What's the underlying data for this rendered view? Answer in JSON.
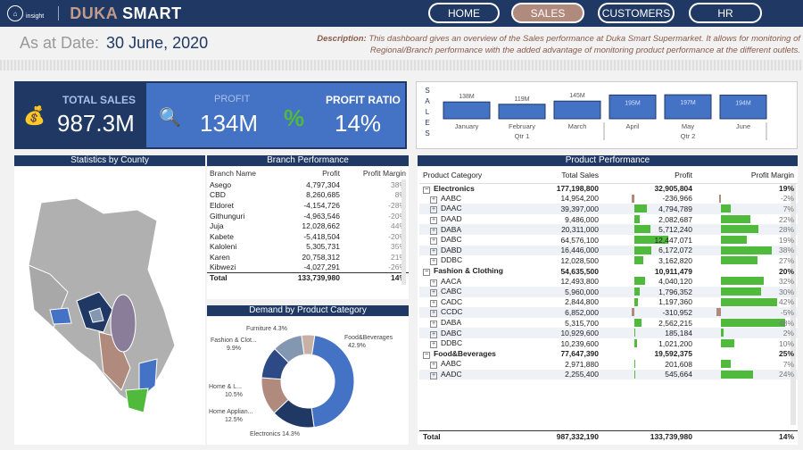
{
  "header": {
    "logo_text": "insight",
    "brand_first": "DUKA",
    "brand_second": "SMART"
  },
  "nav": [
    {
      "label": "HOME"
    },
    {
      "label": "SALES"
    },
    {
      "label": "CUSTOMERS"
    },
    {
      "label": "HR"
    }
  ],
  "date": {
    "label": "As at Date:",
    "value": "30 June, 2020"
  },
  "description": {
    "prefix": "Description:",
    "text": "This dashboard gives an overview of the Sales performance at Duka Smart Supermarket. It allows for monitoring of Regional/Branch performance  with the added advantage of monitoring product performance at the different outlets."
  },
  "kpis": {
    "total_sales": {
      "label": "TOTAL SALES",
      "value": "987.3M"
    },
    "profit": {
      "label": "PROFIT",
      "value": "134M"
    },
    "profit_ratio": {
      "label": "PROFIT RATIO",
      "value": "14%"
    }
  },
  "sales_chart": {
    "vertical_label": "SALES",
    "months": [
      {
        "month": "January",
        "value": "138M",
        "qtr": "Qtr 1"
      },
      {
        "month": "February",
        "value": "119M",
        "qtr": "Qtr 1"
      },
      {
        "month": "March",
        "value": "145M",
        "qtr": "Qtr 1"
      },
      {
        "month": "April",
        "value": "195M",
        "qtr": "Qtr 2"
      },
      {
        "month": "May",
        "value": "197M",
        "qtr": "Qtr 2"
      },
      {
        "month": "June",
        "value": "194M",
        "qtr": "Qtr 2"
      }
    ],
    "qtr1": "Qtr 1",
    "qtr2": "Qtr 2"
  },
  "chart_data": [
    {
      "type": "bar",
      "categories": [
        "January",
        "February",
        "March",
        "April",
        "May",
        "June"
      ],
      "values": [
        138,
        119,
        145,
        195,
        197,
        194
      ],
      "ylabel": "",
      "xlabel": ""
    },
    {
      "type": "pie",
      "categories": [
        "Food&Beverages",
        "Electronics",
        "Home Appliances",
        "Home & Living",
        "Fashion & Clothing",
        "Furniture"
      ],
      "values": [
        42.9,
        14.3,
        12.5,
        10.5,
        9.9,
        4.3
      ]
    }
  ],
  "county": {
    "title": "Statistics by County"
  },
  "branch": {
    "title": "Branch Performance",
    "headers": [
      "Branch Name",
      "Profit",
      "Profit Margin"
    ],
    "rows": [
      [
        "Asego",
        "4,797,304",
        "38%"
      ],
      [
        "CBD",
        "8,260,685",
        "8%"
      ],
      [
        "Eldoret",
        "-4,154,726",
        "-28%"
      ],
      [
        "Githunguri",
        "-4,963,546",
        "-20%"
      ],
      [
        "Juja",
        "12,028,662",
        "44%"
      ],
      [
        "Kabete",
        "-5,418,504",
        "-20%"
      ],
      [
        "Kaloleni",
        "5,305,731",
        "35%"
      ],
      [
        "Karen",
        "20,758,312",
        "21%"
      ],
      [
        "Kibwezi",
        "-4,027,291",
        "-26%"
      ]
    ],
    "total": [
      "Total",
      "133,739,980",
      "14%"
    ]
  },
  "demand": {
    "title": "Demand by Product Category",
    "labels": [
      {
        "name": "Food&Beverages",
        "pct": "42.9%"
      },
      {
        "name": "Electronics",
        "pct": "14.3%"
      },
      {
        "name": "Home Applian...",
        "pct": "12.5%"
      },
      {
        "name": "Home & L...",
        "pct": "10.5%"
      },
      {
        "name": "Fashion & Clot...",
        "pct": "9.9%"
      },
      {
        "name": "Furniture",
        "pct": "4.3%"
      }
    ],
    "colors": [
      "#4472c4",
      "#1f3864",
      "#b08a7c",
      "#2e4a86",
      "#8497b0",
      "#c9b0a6"
    ]
  },
  "product": {
    "title": "Product Performance",
    "headers": [
      "Product Category",
      "Total Sales",
      "Profit",
      "Profit Margin"
    ],
    "rows": [
      {
        "t": "grp",
        "c": "Electronics",
        "s": "177,198,800",
        "p": "32,905,804",
        "m": "19%"
      },
      {
        "t": "sub",
        "c": "AABC",
        "s": "14,954,200",
        "p": "-236,966",
        "m": "-2%",
        "pb": -1,
        "mb": -2
      },
      {
        "t": "sub",
        "c": "DAAC",
        "s": "39,397,000",
        "p": "4,794,789",
        "m": "7%",
        "pb": 20,
        "mb": 7
      },
      {
        "t": "sub",
        "c": "DAAD",
        "s": "9,486,000",
        "p": "2,082,687",
        "m": "22%",
        "pb": 9,
        "mb": 22
      },
      {
        "t": "sub",
        "c": "DABA",
        "s": "20,311,000",
        "p": "5,712,240",
        "m": "28%",
        "pb": 25,
        "mb": 28
      },
      {
        "t": "sub",
        "c": "DABC",
        "s": "64,576,100",
        "p": "12,447,071",
        "m": "19%",
        "pb": 54,
        "mb": 19
      },
      {
        "t": "sub",
        "c": "DABD",
        "s": "16,446,000",
        "p": "6,172,072",
        "m": "38%",
        "pb": 27,
        "mb": 38
      },
      {
        "t": "sub",
        "c": "DDBC",
        "s": "12,028,500",
        "p": "3,162,820",
        "m": "27%",
        "pb": 14,
        "mb": 27
      },
      {
        "t": "grp",
        "c": "Fashion & Clothing",
        "s": "54,635,500",
        "p": "10,911,479",
        "m": "20%"
      },
      {
        "t": "sub",
        "c": "AACA",
        "s": "12,493,800",
        "p": "4,040,120",
        "m": "32%",
        "pb": 17,
        "mb": 32
      },
      {
        "t": "sub",
        "c": "CABC",
        "s": "5,960,000",
        "p": "1,796,352",
        "m": "30%",
        "pb": 8,
        "mb": 30
      },
      {
        "t": "sub",
        "c": "CADC",
        "s": "2,844,800",
        "p": "1,197,360",
        "m": "42%",
        "pb": 5,
        "mb": 42
      },
      {
        "t": "sub",
        "c": "CCDC",
        "s": "6,852,000",
        "p": "-310,952",
        "m": "-5%",
        "pb": -1,
        "mb": -5
      },
      {
        "t": "sub",
        "c": "DABA",
        "s": "5,315,700",
        "p": "2,562,215",
        "m": "48%",
        "pb": 11,
        "mb": 48
      },
      {
        "t": "sub",
        "c": "DABC",
        "s": "10,929,600",
        "p": "185,184",
        "m": "2%",
        "pb": 1,
        "mb": 2
      },
      {
        "t": "sub",
        "c": "DDBC",
        "s": "10,239,600",
        "p": "1,021,200",
        "m": "10%",
        "pb": 4,
        "mb": 10
      },
      {
        "t": "grp",
        "c": "Food&Beverages",
        "s": "77,647,390",
        "p": "19,592,375",
        "m": "25%"
      },
      {
        "t": "sub",
        "c": "AABC",
        "s": "2,971,880",
        "p": "201,608",
        "m": "7%",
        "pb": 1,
        "mb": 7
      },
      {
        "t": "sub",
        "c": "AADC",
        "s": "2,255,400",
        "p": "545,664",
        "m": "24%",
        "pb": 2,
        "mb": 24
      }
    ],
    "total": {
      "c": "Total",
      "s": "987,332,190",
      "p": "133,739,980",
      "m": "14%"
    }
  }
}
